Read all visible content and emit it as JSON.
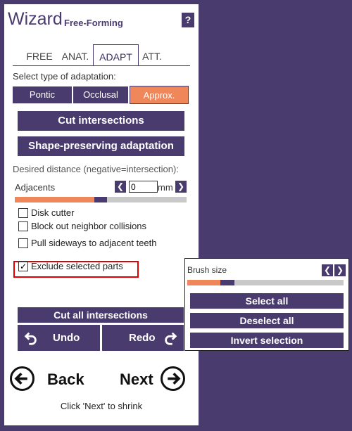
{
  "header": {
    "title": "Wizard",
    "subtitle": "Free-Forming",
    "help_label": "?"
  },
  "tabs": [
    {
      "label": "FREE",
      "active": false
    },
    {
      "label": "ANAT.",
      "active": false
    },
    {
      "label": "ADAPT",
      "active": true
    },
    {
      "label": "ATT.",
      "active": false
    }
  ],
  "adaptation": {
    "prompt": "Select type of adaptation:",
    "options": [
      {
        "label": "Pontic",
        "selected": false
      },
      {
        "label": "Occlusal",
        "selected": false
      },
      {
        "label": "Approx.",
        "selected": true
      }
    ]
  },
  "buttons": {
    "cut_intersections": "Cut intersections",
    "shape_preserving": "Shape-preserving adaptation",
    "cut_all": "Cut all intersections",
    "undo": "Undo",
    "redo": "Redo"
  },
  "distance": {
    "label": "Desired distance (negative=intersection):",
    "adjacents_label": "Adjacents",
    "value": "0",
    "unit": "mm"
  },
  "checkboxes": [
    {
      "label": "Disk cutter",
      "checked": false
    },
    {
      "label": "Block out neighbor collisions",
      "checked": false
    },
    {
      "label": "Pull sideways to adjacent teeth",
      "checked": false
    },
    {
      "label": "Exclude selected parts",
      "checked": true
    }
  ],
  "nav": {
    "back": "Back",
    "next": "Next",
    "hint": "Click 'Next' to shrink"
  },
  "popup": {
    "brush_label": "Brush size",
    "select_all": "Select all",
    "deselect_all": "Deselect all",
    "invert_selection": "Invert selection"
  },
  "colors": {
    "brand": "#4a3b6e",
    "accent": "#f0875a",
    "highlight": "#e00000"
  }
}
